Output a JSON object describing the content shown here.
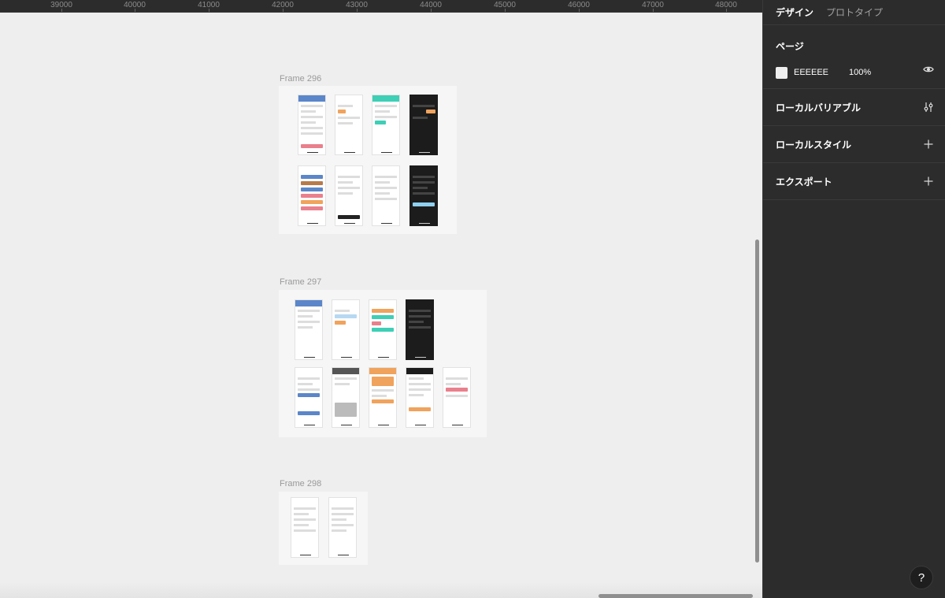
{
  "ruler": {
    "ticks": [
      "39000",
      "40000",
      "41000",
      "42000",
      "43000",
      "44000",
      "45000",
      "46000",
      "47000",
      "48000"
    ]
  },
  "canvas": {
    "background": "#EEEEEE",
    "frames": [
      {
        "name": "Frame 296"
      },
      {
        "name": "Frame 297"
      },
      {
        "name": "Frame 298"
      }
    ]
  },
  "panel": {
    "tabs": [
      "デザイン",
      "プロトタイプ"
    ],
    "active_tab": "デザイン",
    "page": {
      "title": "ページ",
      "fill_hex": "EEEEEE",
      "opacity": "100%"
    },
    "sections": [
      {
        "title": "ローカルバリアブル",
        "icon": "sliders-icon"
      },
      {
        "title": "ローカルスタイル",
        "icon": "plus-icon"
      },
      {
        "title": "エクスポート",
        "icon": "plus-icon"
      }
    ],
    "help_label": "?"
  },
  "colors": {
    "panel_bg": "#2C2C2C",
    "canvas_bg": "#EEEEEE",
    "accent_blue": "#5b86c9",
    "accent_teal": "#3ecfb6",
    "accent_orange": "#f0a35c",
    "accent_pink": "#e9808c"
  }
}
